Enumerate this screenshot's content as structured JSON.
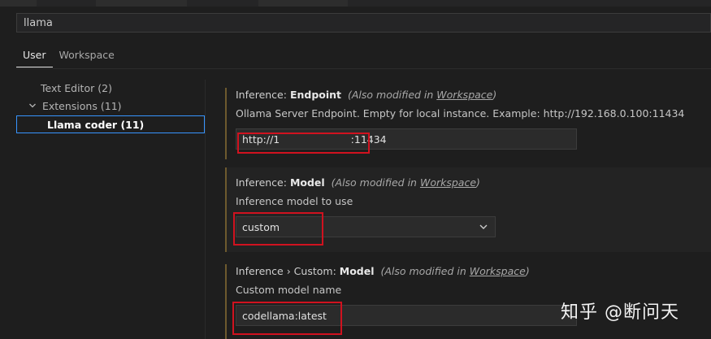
{
  "search": {
    "value": "llama"
  },
  "tabs": [
    {
      "label": "User",
      "active": true
    },
    {
      "label": "Workspace",
      "active": false
    }
  ],
  "toc": {
    "items": [
      {
        "label": "Text Editor",
        "count": "(2)"
      },
      {
        "label": "Extensions",
        "count": "(11)",
        "expanded": true
      },
      {
        "label": "Llama coder",
        "count": "(11)",
        "selected": true
      }
    ]
  },
  "settings": [
    {
      "category": "Inference: ",
      "name": "Endpoint",
      "modified_prefix": "(Also modified in ",
      "modified_link": "Workspace",
      "modified_suffix": ")",
      "description": "Ollama Server Endpoint. Empty for local instance. Example: http://192.168.0.100:11434",
      "value": "http://1                      :11434"
    },
    {
      "category": "Inference: ",
      "name": "Model",
      "modified_prefix": "(Also modified in ",
      "modified_link": "Workspace",
      "modified_suffix": ")",
      "description": "Inference model to use",
      "value": "custom"
    },
    {
      "category": "Inference › Custom: ",
      "name": "Model",
      "modified_prefix": "(Also modified in ",
      "modified_link": "Workspace",
      "modified_suffix": ")",
      "description": "Custom model name",
      "value": "codellama:latest"
    }
  ],
  "watermark": {
    "text": "知乎 @断问天"
  },
  "colors": {
    "highlight": "#d0121f",
    "focus_border": "#3794ff",
    "modified_bar": "#6e5a2e",
    "background": "#1e1e1e"
  }
}
